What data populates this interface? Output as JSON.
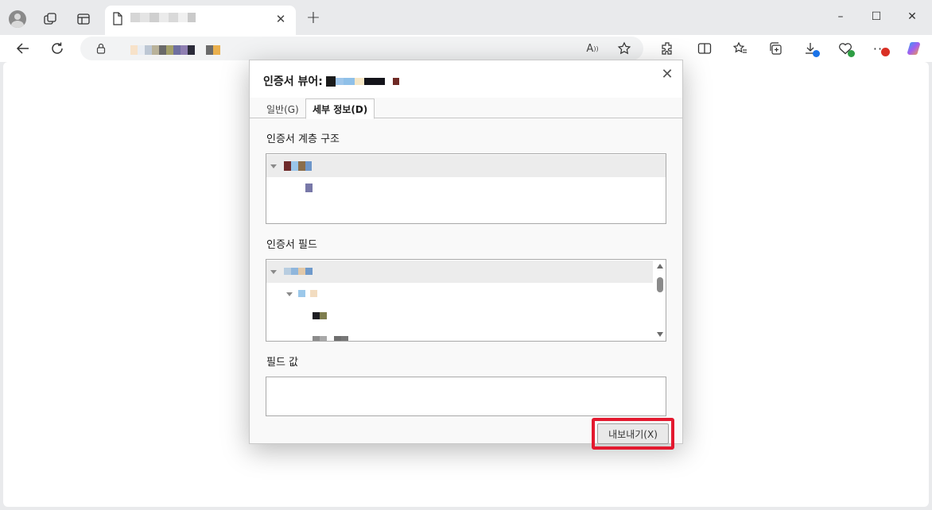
{
  "browser": {
    "new_tab_symbol": "+",
    "tab_close_symbol": "✕",
    "window_controls": {
      "minimize": "–",
      "maximize": "☐",
      "close": "✕"
    },
    "icons": [
      "profile-avatar-icon",
      "workspaces-icon",
      "tab-actions-icon",
      "page-icon",
      "back-icon",
      "refresh-icon",
      "lock-icon",
      "read-aloud-icon",
      "favorite-star-icon",
      "extensions-icon",
      "split-screen-icon",
      "favorites-icon",
      "collections-icon",
      "downloads-icon",
      "browser-essentials-icon",
      "more-icon",
      "copilot-icon"
    ],
    "colors": {
      "downloads_badge": "#1a73e8",
      "essentials_badge": "#2e9e44",
      "more_badge": "#d93025"
    }
  },
  "dialog": {
    "title": "인증서 뷰어:",
    "close_symbol": "✕",
    "tabs": [
      {
        "label": "일반(G)",
        "active": false
      },
      {
        "label": "세부 정보(D)",
        "active": true
      }
    ],
    "hierarchy_label": "인증서 계층 구조",
    "fields_label": "인증서 필드",
    "field_value_label": "필드 값",
    "export_button": "내보내기(X)",
    "highlight_color": "#e3192f"
  }
}
